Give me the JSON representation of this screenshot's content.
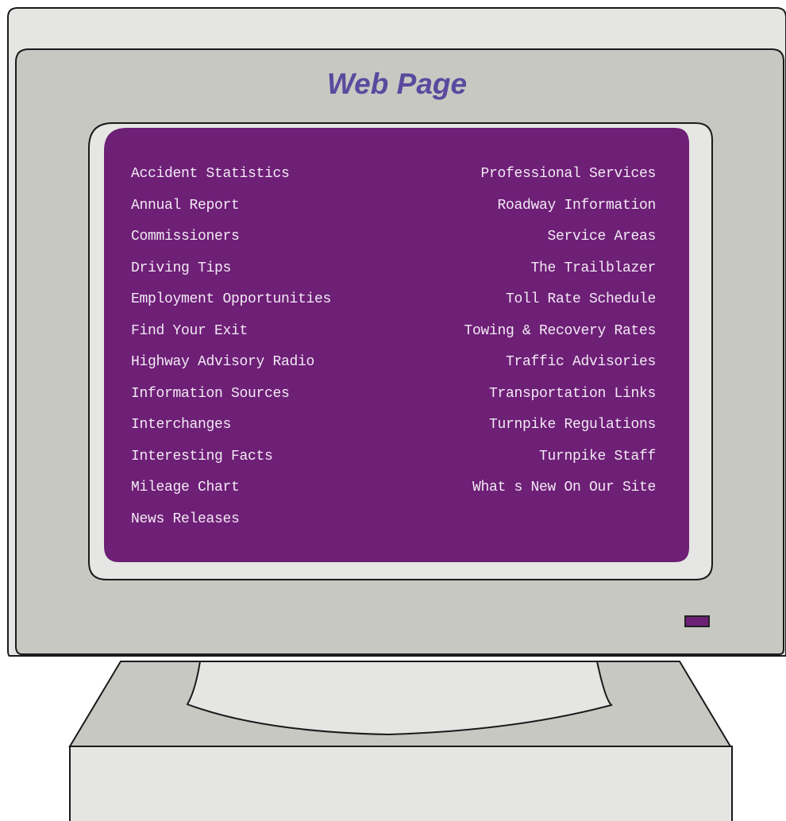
{
  "page": {
    "title": "Web Page"
  },
  "links": {
    "left": [
      "Accident Statistics",
      "Annual Report",
      "Commissioners",
      "Driving Tips",
      "Employment Opportunities",
      "Find Your Exit",
      "Highway Advisory Radio",
      "Information Sources",
      "Interchanges",
      "Interesting Facts",
      "Mileage Chart",
      "News Releases"
    ],
    "right": [
      "Professional Services",
      "Roadway Information",
      "Service Areas",
      "The Trailblazer",
      "Toll Rate Schedule",
      "Towing & Recovery Rates",
      "Traffic Advisories",
      "Transportation Links",
      "Turnpike Regulations",
      "Turnpike Staff",
      "What s New On Our Site"
    ]
  },
  "colors": {
    "screen": "#6e1f76",
    "title": "#5a4a9e",
    "bezel": "#c8c8c3",
    "body_light": "#e5e5e3",
    "outline": "#1a1a1a",
    "link_text": "#f2eaf4"
  }
}
